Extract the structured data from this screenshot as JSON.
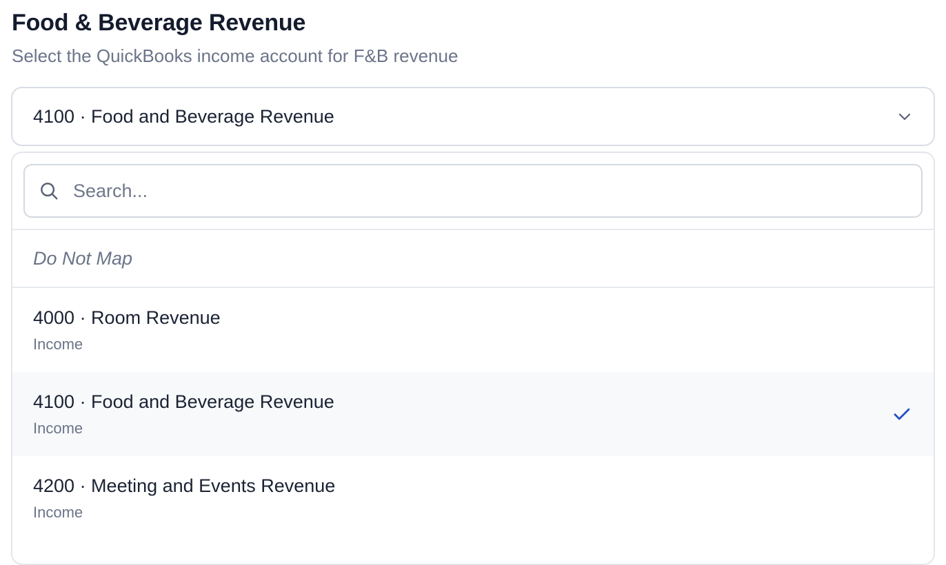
{
  "section": {
    "title": "Food & Beverage Revenue",
    "subtitle": "Select the QuickBooks income account for F&B revenue"
  },
  "select": {
    "selected_value": "4100 · Food and Beverage Revenue",
    "chevron_icon": "chevron-down-icon"
  },
  "dropdown": {
    "search_placeholder": "Search...",
    "search_value": "",
    "search_icon": "search-icon",
    "no_map_label": "Do Not Map",
    "options": [
      {
        "name": "4000 · Room Revenue",
        "type": "Income",
        "selected": false
      },
      {
        "name": "4100 · Food and Beverage Revenue",
        "type": "Income",
        "selected": true
      },
      {
        "name": "4200 · Meeting and Events Revenue",
        "type": "Income",
        "selected": false
      }
    ],
    "check_icon": "check-icon"
  },
  "colors": {
    "text_primary": "#1a2233",
    "text_muted": "#6b7488",
    "border": "#d9dde5",
    "selected_bg": "#f8f9fb",
    "check_accent": "#1f4fc4"
  }
}
